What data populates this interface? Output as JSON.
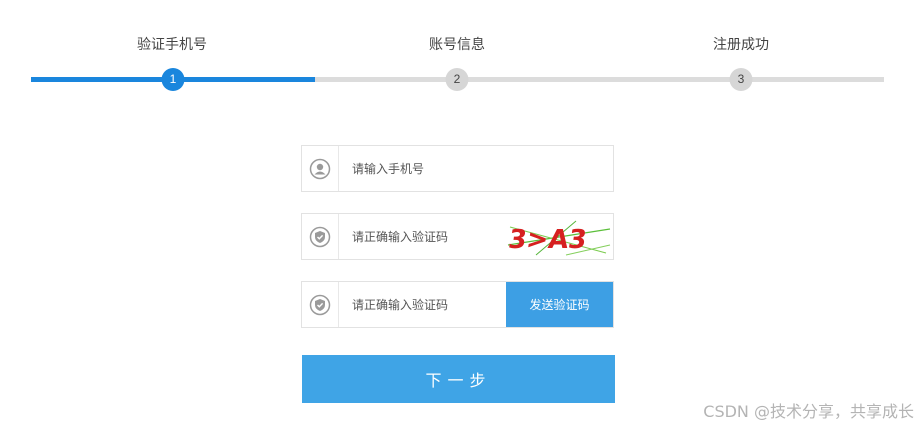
{
  "steps": [
    {
      "label": "验证手机号",
      "number": "1",
      "state": "active"
    },
    {
      "label": "账号信息",
      "number": "2",
      "state": "pending"
    },
    {
      "label": "注册成功",
      "number": "3",
      "state": "pending"
    }
  ],
  "form": {
    "phone": {
      "placeholder": "请输入手机号",
      "icon": "user-icon"
    },
    "captcha": {
      "placeholder": "请正确输入验证码",
      "icon": "shield-check-icon",
      "captcha_text": "3>A3"
    },
    "sms": {
      "placeholder": "请正确输入验证码",
      "icon": "shield-check-icon",
      "send_label": "发送验证码"
    },
    "next_label": "下一步"
  },
  "watermark": "CSDN @技术分享，共享成长",
  "colors": {
    "accent": "#1a86dd",
    "button": "#3fa4e6",
    "track_inactive": "#dcdcdc"
  }
}
